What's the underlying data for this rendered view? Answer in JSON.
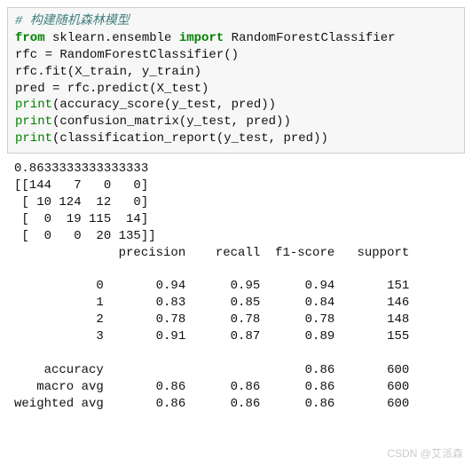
{
  "code": {
    "comment": "# 构建随机森林模型",
    "kw_from": "from",
    "mod": " sklearn.ensemble ",
    "kw_import": "import",
    "cls": " RandomForestClassifier",
    "line3": "rfc = RandomForestClassifier()",
    "line4": "rfc.fit(X_train, y_train)",
    "line5": "pred = rfc.predict(X_test)",
    "print": "print",
    "p1a": "(accuracy_score(y_test, pred))",
    "p2a": "(confusion_matrix(y_test, pred))",
    "p3a": "(classification_report(y_test, pred))"
  },
  "output": {
    "accuracy": "0.8633333333333333",
    "cm1": "[[144   7   0   0]",
    "cm2": " [ 10 124  12   0]",
    "cm3": " [  0  19 115  14]",
    "cm4": " [  0   0  20 135]]",
    "hdr": "              precision    recall  f1-score   support",
    "blank": "",
    "r0": "           0       0.94      0.95      0.94       151",
    "r1": "           1       0.83      0.85      0.84       146",
    "r2": "           2       0.78      0.78      0.78       148",
    "r3": "           3       0.91      0.87      0.89       155",
    "acc_row": "    accuracy                           0.86       600",
    "macro": "   macro avg       0.86      0.86      0.86       600",
    "weighted": "weighted avg       0.86      0.86      0.86       600"
  },
  "chart_data": {
    "type": "table",
    "title": "classification_report",
    "accuracy_score": 0.8633333333333333,
    "confusion_matrix": [
      [
        144,
        7,
        0,
        0
      ],
      [
        10,
        124,
        12,
        0
      ],
      [
        0,
        19,
        115,
        14
      ],
      [
        0,
        0,
        20,
        135
      ]
    ],
    "columns": [
      "precision",
      "recall",
      "f1-score",
      "support"
    ],
    "rows": [
      {
        "label": "0",
        "precision": 0.94,
        "recall": 0.95,
        "f1-score": 0.94,
        "support": 151
      },
      {
        "label": "1",
        "precision": 0.83,
        "recall": 0.85,
        "f1-score": 0.84,
        "support": 146
      },
      {
        "label": "2",
        "precision": 0.78,
        "recall": 0.78,
        "f1-score": 0.78,
        "support": 148
      },
      {
        "label": "3",
        "precision": 0.91,
        "recall": 0.87,
        "f1-score": 0.89,
        "support": 155
      },
      {
        "label": "accuracy",
        "precision": null,
        "recall": null,
        "f1-score": 0.86,
        "support": 600
      },
      {
        "label": "macro avg",
        "precision": 0.86,
        "recall": 0.86,
        "f1-score": 0.86,
        "support": 600
      },
      {
        "label": "weighted avg",
        "precision": 0.86,
        "recall": 0.86,
        "f1-score": 0.86,
        "support": 600
      }
    ]
  },
  "watermark": "CSDN @艾派森"
}
